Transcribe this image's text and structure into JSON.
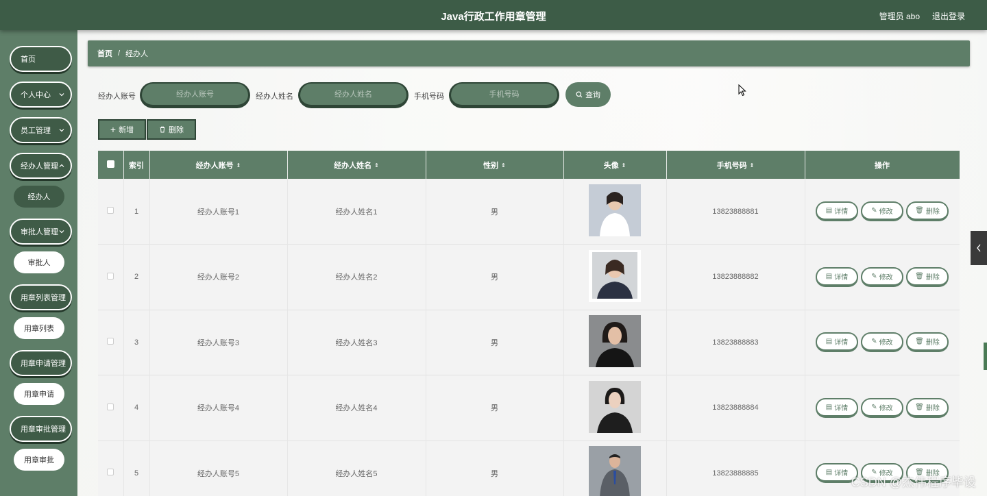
{
  "header": {
    "title": "Java行政工作用章管理",
    "user_label": "管理员 abo",
    "logout_label": "退出登录"
  },
  "sidebar": {
    "items": [
      {
        "label": "首页",
        "expandable": false
      },
      {
        "label": "个人中心",
        "expandable": true
      },
      {
        "label": "员工管理",
        "expandable": true
      },
      {
        "label": "经办人管理",
        "expandable": true,
        "sub": "经办人",
        "sub_active": true
      },
      {
        "label": "审批人管理",
        "expandable": true,
        "sub": "审批人"
      },
      {
        "label": "用章列表管理",
        "expandable": true,
        "sub": "用章列表"
      },
      {
        "label": "用章申请管理",
        "expandable": true,
        "sub": "用章申请"
      },
      {
        "label": "用章审批管理",
        "expandable": true,
        "sub": "用章审批"
      }
    ]
  },
  "breadcrumb": {
    "home": "首页",
    "separator": "/",
    "current": "经办人"
  },
  "search": {
    "account_label": "经办人账号",
    "account_placeholder": "经办人账号",
    "name_label": "经办人姓名",
    "name_placeholder": "经办人姓名",
    "phone_label": "手机号码",
    "phone_placeholder": "手机号码",
    "query_label": "查询"
  },
  "actions": {
    "add_label": "新增",
    "delete_label": "删除"
  },
  "table": {
    "headers": [
      "索引",
      "经办人账号",
      "经办人姓名",
      "性别",
      "头像",
      "手机号码",
      "操作"
    ],
    "row_actions": {
      "detail": "详情",
      "edit": "修改",
      "delete": "删除"
    },
    "rows": [
      {
        "index": "1",
        "account": "经办人账号1",
        "name": "经办人姓名1",
        "gender": "男",
        "phone": "13823888881"
      },
      {
        "index": "2",
        "account": "经办人账号2",
        "name": "经办人姓名2",
        "gender": "男",
        "phone": "13823888882"
      },
      {
        "index": "3",
        "account": "经办人账号3",
        "name": "经办人姓名3",
        "gender": "男",
        "phone": "13823888883"
      },
      {
        "index": "4",
        "account": "经办人账号4",
        "name": "经办人姓名4",
        "gender": "男",
        "phone": "13823888884"
      },
      {
        "index": "5",
        "account": "经办人账号5",
        "name": "经办人姓名5",
        "gender": "男",
        "phone": "13823888885"
      }
    ]
  },
  "watermark": "CSDN @杰伟程序毕设",
  "colors": {
    "primary": "#5e7e68",
    "dark": "#3d5c47",
    "border_dark": "#2e4536"
  }
}
